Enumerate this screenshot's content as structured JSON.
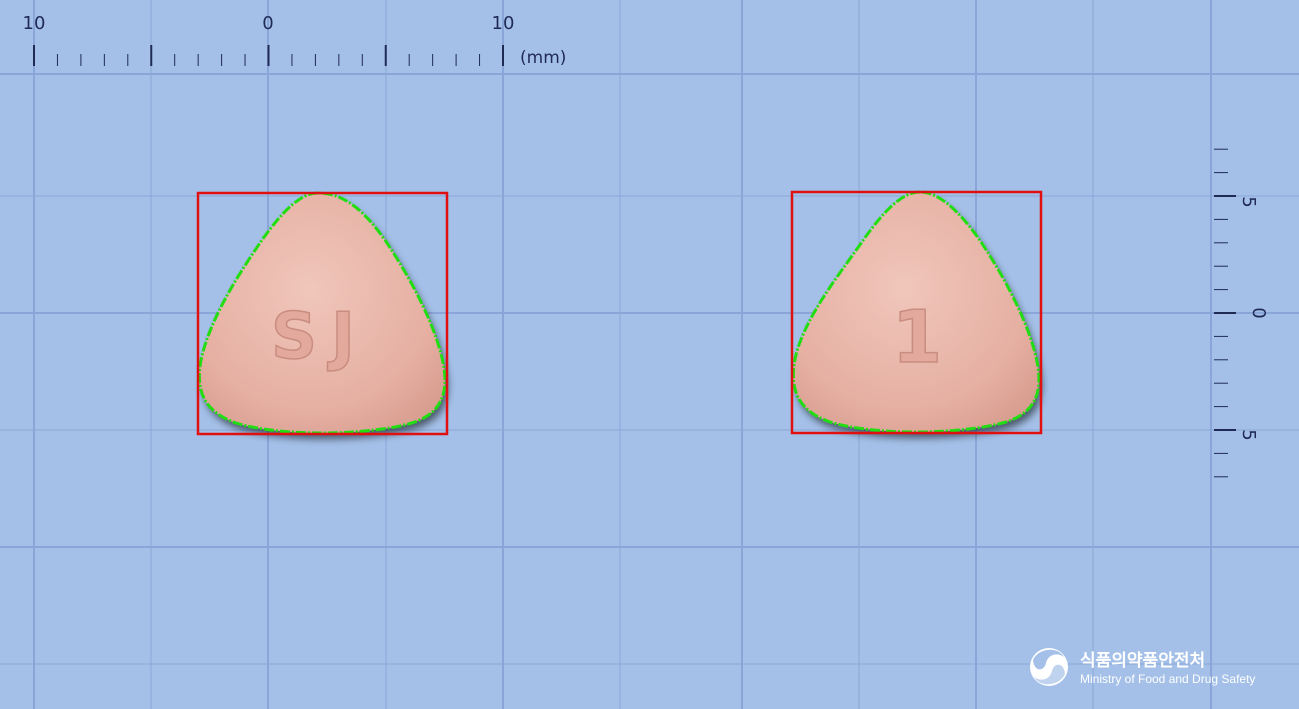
{
  "image": {
    "background_color": "#a4c0e8",
    "grid_color": "#8aa6d8"
  },
  "top_ruler": {
    "tick_labels": [
      "10",
      "0",
      "10"
    ],
    "unit": "(mm)"
  },
  "right_ruler": {
    "tick_labels": [
      "5",
      "0",
      "5"
    ]
  },
  "pills": [
    {
      "view": "front",
      "imprint": "SJ",
      "color": "#e8b4a8"
    },
    {
      "view": "back",
      "imprint": "1",
      "color": "#e8b4a8"
    }
  ],
  "overlay_colors": {
    "bounding_box": "#e01010",
    "contour": "#22dd11"
  },
  "logo": {
    "name_korean": "식품의약품안전처",
    "name_english": "Ministry of Food and Drug Safety"
  }
}
